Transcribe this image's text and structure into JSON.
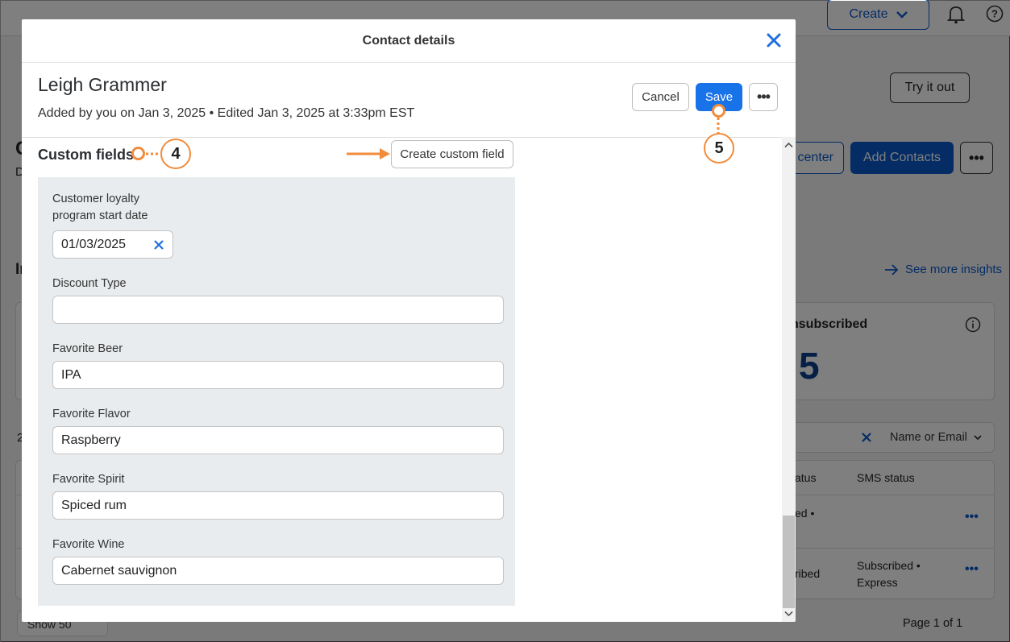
{
  "background": {
    "create_label": "Create",
    "try_it_out": "Try it out",
    "center_label": "center",
    "add_contacts": "Add Contacts",
    "see_more_insights": "See more insights",
    "unsubscribed_label": "nsubscribed",
    "unsubscribed_count": "5",
    "filter_select": "Name or Email",
    "col_status": "atus",
    "col_sms_status": "SMS status",
    "row1_status": "ed •",
    "row2_status": "ribed",
    "row2_sms": "Subscribed •",
    "row2_sms_2": "Express",
    "show_select": "Show 50",
    "pagination": "Page 1 of 1",
    "left_fragments": [
      "C",
      "D",
      "In",
      "2"
    ]
  },
  "modal": {
    "title": "Contact details",
    "contact_name": "Leigh Grammer",
    "contact_meta": "Added by you on Jan 3, 2025 • Edited Jan 3, 2025 at 3:33pm EST",
    "cancel_label": "Cancel",
    "save_label": "Save",
    "section_title": "Custom fields",
    "create_field_label": "Create custom field",
    "fields": [
      {
        "label_line1": "Customer loyalty",
        "label_line2": "program start date",
        "value": "01/03/2025"
      },
      {
        "label": "Discount Type",
        "value": ""
      },
      {
        "label": "Favorite Beer",
        "value": "IPA"
      },
      {
        "label": "Favorite Flavor",
        "value": "Raspberry"
      },
      {
        "label": "Favorite Spirit",
        "value": "Spiced rum"
      },
      {
        "label": "Favorite Wine",
        "value": "Cabernet sauvignon"
      }
    ]
  },
  "callouts": {
    "step4": "4",
    "step5": "5"
  },
  "icons": [
    "close-icon",
    "clear-icon",
    "more-icon",
    "arrow-right-icon",
    "bell-icon",
    "help-icon",
    "chevron-down-icon",
    "info-icon",
    "scroll-up-icon",
    "scroll-down-icon"
  ],
  "colors": {
    "primary": "#1872e8",
    "callout": "#f28c3b",
    "panel": "#e9ecee"
  }
}
